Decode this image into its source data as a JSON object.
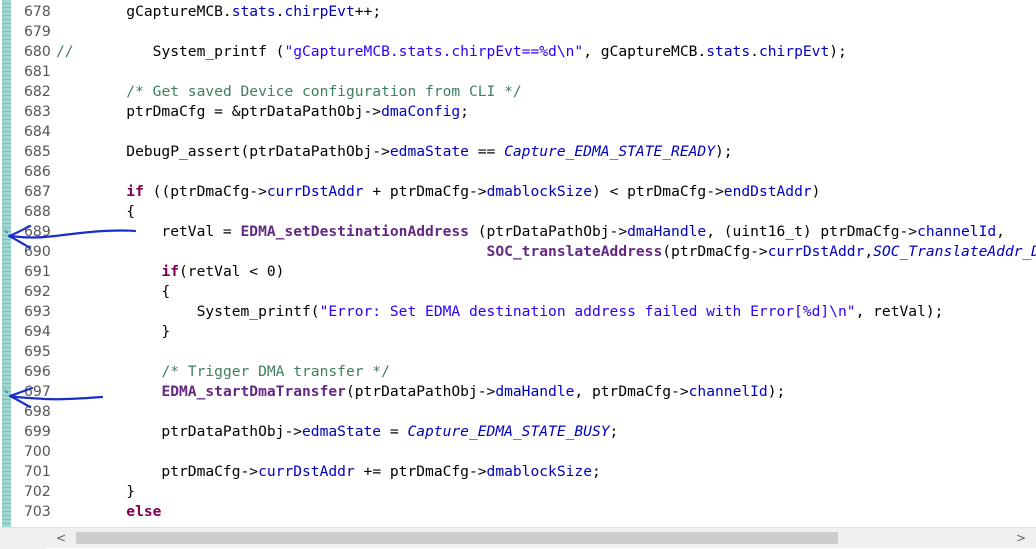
{
  "editor": {
    "lines": [
      {
        "num": "678",
        "tokens": [
          [
            "plain",
            "        gCaptureMCB."
          ],
          [
            "field",
            "stats"
          ],
          [
            "plain",
            "."
          ],
          [
            "field",
            "chirpEvt"
          ],
          [
            "plain",
            "++;"
          ]
        ]
      },
      {
        "num": "679",
        "tokens": []
      },
      {
        "num": "680",
        "tokens": [
          [
            "lcomment",
            "//"
          ],
          [
            "plain",
            "         System_printf ("
          ],
          [
            "string",
            "\"gCaptureMCB.stats.chirpEvt==%d\\n\""
          ],
          [
            "plain",
            ", gCaptureMCB."
          ],
          [
            "field",
            "stats"
          ],
          [
            "plain",
            "."
          ],
          [
            "field",
            "chirpEvt"
          ],
          [
            "plain",
            ");"
          ]
        ]
      },
      {
        "num": "681",
        "tokens": []
      },
      {
        "num": "682",
        "tokens": [
          [
            "plain",
            "        "
          ],
          [
            "comment",
            "/* Get saved Device configuration from CLI */"
          ]
        ]
      },
      {
        "num": "683",
        "tokens": [
          [
            "plain",
            "        ptrDmaCfg = &ptrDataPathObj->"
          ],
          [
            "field",
            "dmaConfig"
          ],
          [
            "plain",
            ";"
          ]
        ]
      },
      {
        "num": "684",
        "tokens": []
      },
      {
        "num": "685",
        "tokens": [
          [
            "plain",
            "        DebugP_assert(ptrDataPathObj->"
          ],
          [
            "field",
            "edmaState"
          ],
          [
            "plain",
            " == "
          ],
          [
            "enum",
            "Capture_EDMA_STATE_READY"
          ],
          [
            "plain",
            ");"
          ]
        ]
      },
      {
        "num": "686",
        "tokens": []
      },
      {
        "num": "687",
        "tokens": [
          [
            "plain",
            "        "
          ],
          [
            "keyword",
            "if"
          ],
          [
            "plain",
            " ((ptrDmaCfg->"
          ],
          [
            "field",
            "currDstAddr"
          ],
          [
            "plain",
            " + ptrDmaCfg->"
          ],
          [
            "field",
            "dmablockSize"
          ],
          [
            "plain",
            ") < ptrDmaCfg->"
          ],
          [
            "field",
            "endDstAddr"
          ],
          [
            "plain",
            ")"
          ]
        ]
      },
      {
        "num": "688",
        "tokens": [
          [
            "plain",
            "        {"
          ]
        ]
      },
      {
        "num": "689",
        "tokens": [
          [
            "plain",
            "            retVal = "
          ],
          [
            "func",
            "EDMA_setDestinationAddress"
          ],
          [
            "plain",
            " (ptrDataPathObj->"
          ],
          [
            "field",
            "dmaHandle"
          ],
          [
            "plain",
            ", (uint16_t) ptrDmaCfg->"
          ],
          [
            "field",
            "channelId"
          ],
          [
            "plain",
            ","
          ]
        ]
      },
      {
        "num": "690",
        "tokens": [
          [
            "plain",
            "                                                 "
          ],
          [
            "func",
            "SOC_translateAddress"
          ],
          [
            "plain",
            "(ptrDmaCfg->"
          ],
          [
            "field",
            "currDstAddr"
          ],
          [
            "plain",
            ","
          ],
          [
            "enum",
            "SOC_TranslateAddr_Dir_TO_EDMA"
          ],
          [
            "plain",
            ", NULL));"
          ]
        ]
      },
      {
        "num": "691",
        "tokens": [
          [
            "plain",
            "            "
          ],
          [
            "keyword",
            "if"
          ],
          [
            "plain",
            "(retVal < 0)"
          ]
        ]
      },
      {
        "num": "692",
        "tokens": [
          [
            "plain",
            "            {"
          ]
        ]
      },
      {
        "num": "693",
        "tokens": [
          [
            "plain",
            "                System_printf("
          ],
          [
            "string",
            "\"Error: Set EDMA destination address failed with Error[%d]\\n\""
          ],
          [
            "plain",
            ", retVal);"
          ]
        ]
      },
      {
        "num": "694",
        "tokens": [
          [
            "plain",
            "            }"
          ]
        ]
      },
      {
        "num": "695",
        "tokens": []
      },
      {
        "num": "696",
        "tokens": [
          [
            "plain",
            "            "
          ],
          [
            "comment",
            "/* Trigger DMA transfer */"
          ]
        ]
      },
      {
        "num": "697",
        "tokens": [
          [
            "plain",
            "            "
          ],
          [
            "func",
            "EDMA_startDmaTransfer"
          ],
          [
            "plain",
            "(ptrDataPathObj->"
          ],
          [
            "field",
            "dmaHandle"
          ],
          [
            "plain",
            ", ptrDmaCfg->"
          ],
          [
            "field",
            "channelId"
          ],
          [
            "plain",
            ");"
          ]
        ]
      },
      {
        "num": "698",
        "tokens": []
      },
      {
        "num": "699",
        "tokens": [
          [
            "plain",
            "            ptrDataPathObj->"
          ],
          [
            "field",
            "edmaState"
          ],
          [
            "plain",
            " = "
          ],
          [
            "enum",
            "Capture_EDMA_STATE_BUSY"
          ],
          [
            "plain",
            ";"
          ]
        ]
      },
      {
        "num": "700",
        "tokens": []
      },
      {
        "num": "701",
        "tokens": [
          [
            "plain",
            "            ptrDmaCfg->"
          ],
          [
            "field",
            "currDstAddr"
          ],
          [
            "plain",
            " += ptrDmaCfg->"
          ],
          [
            "field",
            "dmablockSize"
          ],
          [
            "plain",
            ";"
          ]
        ]
      },
      {
        "num": "702",
        "tokens": [
          [
            "plain",
            "        }"
          ]
        ]
      },
      {
        "num": "703",
        "tokens": [
          [
            "plain",
            "        "
          ],
          [
            "keyword",
            "else"
          ]
        ]
      }
    ],
    "bookmark_lines": [
      "689",
      "697"
    ]
  },
  "scrollbar": {
    "left_arrow": "<",
    "right_arrow": ">"
  },
  "annotations": {
    "arrow_color": "#1a2fc7"
  },
  "colors": {
    "field": "#0000c0",
    "comment": "#3f7f5f",
    "keyword": "#7f0055",
    "function": "#642880",
    "string": "#2a00ff"
  }
}
